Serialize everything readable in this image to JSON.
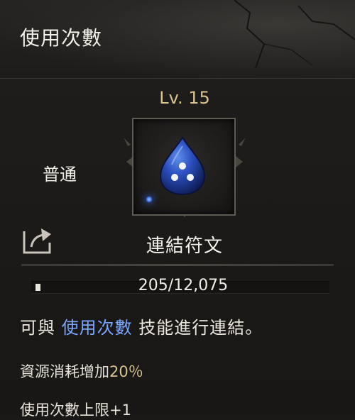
{
  "header": {
    "title": "使用次數"
  },
  "rune": {
    "level": "Lv. 15",
    "rarity": "普通",
    "name": "連結符文",
    "icon": "blue-teardrop-rune-icon",
    "xp_text": "205/12,075",
    "xp_fraction": 0.017
  },
  "description": {
    "prefix": "可與",
    "skill": "使用次數",
    "suffix": "技能進行連結。"
  },
  "stats": {
    "line1_label": "資源消耗增加",
    "line1_value": "20％",
    "line2": "使用次數上限+1"
  },
  "colors": {
    "skill_highlight": "#7aa6ff",
    "level_gold": "#d9c48f",
    "rune_blue": "#1f3f9a"
  }
}
